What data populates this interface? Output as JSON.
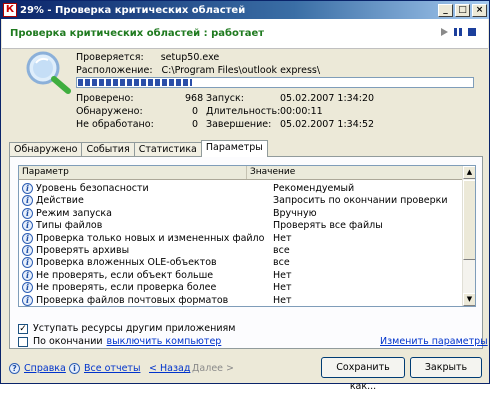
{
  "window": {
    "title": "29% - Проверка критических областей",
    "app_icon": "К",
    "minimize": "_",
    "maximize": "□",
    "close": "×"
  },
  "header": {
    "status_text": "Проверка критических областей : работает"
  },
  "scan": {
    "checking_label": "Проверяется:",
    "checking_value": "setup50.exe",
    "location_label": "Расположение:",
    "location_value": "C:\\Program Files\\outlook express\\",
    "progress": 0.29,
    "checked_label": "Проверено:",
    "checked_value": "968",
    "detected_label": "Обнаружено:",
    "detected_value": "0",
    "unprocessed_label": "Не обработано:",
    "unprocessed_value": "0",
    "start_label": "Запуск:",
    "start_value": "05.02.2007 1:34:20",
    "duration_label": "Длительность:",
    "duration_value": "00:00:11",
    "finish_label": "Завершение:",
    "finish_value": "05.02.2007 1:34:52"
  },
  "tabs": [
    {
      "label": "Обнаружено"
    },
    {
      "label": "События"
    },
    {
      "label": "Статистика"
    },
    {
      "label": "Параметры"
    }
  ],
  "grid": {
    "col_param": "Параметр",
    "col_value": "Значение",
    "rows": [
      {
        "param": "Уровень безопасности",
        "value": "Рекомендуемый"
      },
      {
        "param": "Действие",
        "value": "Запросить по окончании проверки"
      },
      {
        "param": "Режим запуска",
        "value": "Вручную"
      },
      {
        "param": "Типы файлов",
        "value": "Проверять все файлы"
      },
      {
        "param": "Проверка только новых и измененных файлов",
        "value": "Нет"
      },
      {
        "param": "Проверять архивы",
        "value": "все"
      },
      {
        "param": "Проверка вложенных OLE-объектов",
        "value": "все"
      },
      {
        "param": "Не проверять, если объект больше",
        "value": "Нет"
      },
      {
        "param": "Не проверять, если проверка более",
        "value": "Нет"
      },
      {
        "param": "Проверка файлов почтовых форматов",
        "value": "Нет"
      }
    ]
  },
  "options": {
    "yield_label": "Уступать ресурсы другим приложениям",
    "yield_checked": true,
    "on_finish_label": "По окончании",
    "shutdown_link": "выключить компьютер",
    "on_finish_checked": false,
    "change_params_link": "Изменить параметры"
  },
  "footer": {
    "help": "Справка",
    "all_reports": "Все отчеты",
    "back": "< Назад",
    "next": "Далее >",
    "save_as": "Сохранить как...",
    "close": "Закрыть"
  }
}
